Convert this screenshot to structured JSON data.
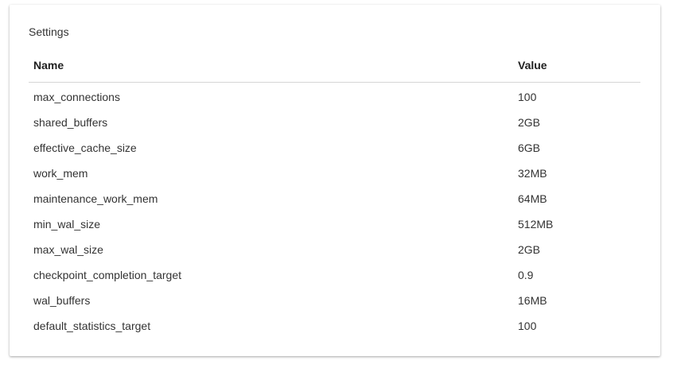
{
  "card": {
    "title": "Settings"
  },
  "table": {
    "headers": {
      "name": "Name",
      "value": "Value"
    },
    "rows": [
      {
        "name": "max_connections",
        "value": "100"
      },
      {
        "name": "shared_buffers",
        "value": "2GB"
      },
      {
        "name": "effective_cache_size",
        "value": "6GB"
      },
      {
        "name": "work_mem",
        "value": "32MB"
      },
      {
        "name": "maintenance_work_mem",
        "value": "64MB"
      },
      {
        "name": "min_wal_size",
        "value": "512MB"
      },
      {
        "name": "max_wal_size",
        "value": "2GB"
      },
      {
        "name": "checkpoint_completion_target",
        "value": "0.9"
      },
      {
        "name": "wal_buffers",
        "value": "16MB"
      },
      {
        "name": "default_statistics_target",
        "value": "100"
      }
    ]
  }
}
